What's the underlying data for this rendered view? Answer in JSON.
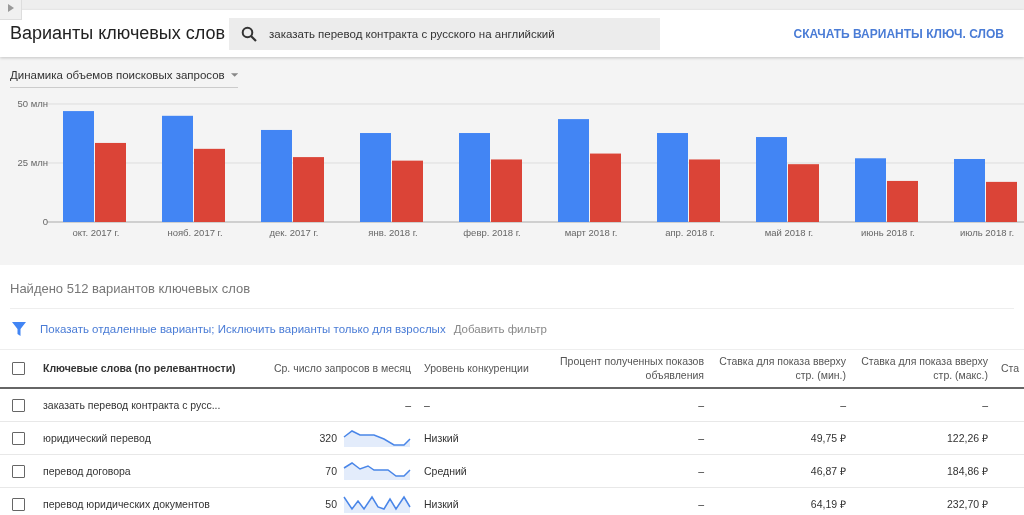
{
  "header": {
    "title": "Варианты ключевых слов",
    "search": {
      "value": "заказать перевод контракта с русского на английский"
    },
    "download_link": "СКАЧАТЬ ВАРИАНТЫ КЛЮЧ. СЛОВ"
  },
  "chart_panel": {
    "dropdown": "Динамика объемов поисковых запросов",
    "chart_data": {
      "type": "bar",
      "categories": [
        "окт. 2017 г.",
        "нояб. 2017 г.",
        "дек. 2017 г.",
        "янв. 2018 г.",
        "февр. 2018 г.",
        "март 2018 г.",
        "апр. 2018 г.",
        "май 2018 г.",
        "июнь 2018 г.",
        "июль 2018 г."
      ],
      "series": [
        {
          "color": "#4285f4",
          "values": [
            47,
            45,
            39,
            37.7,
            37.7,
            43.6,
            37.7,
            36,
            27,
            26.7
          ]
        },
        {
          "color": "#db4437",
          "values": [
            33.5,
            31,
            27.5,
            26,
            26.5,
            29,
            26.5,
            24.5,
            17.4,
            17
          ]
        }
      ],
      "ylim": [
        0,
        50
      ],
      "yticks": [
        {
          "value": 0,
          "label": "0"
        },
        {
          "value": 25,
          "label": "25 млн"
        },
        {
          "value": 50,
          "label": "50 млн"
        }
      ]
    }
  },
  "results": {
    "summary": "Найдено 512 вариантов ключевых слов",
    "filter_link": "Показать отдаленные варианты; Исключить варианты только для взрослых",
    "add_filter": "Добавить фильтр"
  },
  "table": {
    "select_all_checked": false,
    "columns": [
      "Ключевые слова (по релевантности)",
      "Ср. число запросов в месяц",
      "Уровень конкуренции",
      "Процент полученных показов объявления",
      "Ставка для показа вверху стр. (мин.)",
      "Ставка для показа вверху стр. (макс.)",
      "Ста"
    ],
    "rows": [
      {
        "checked": false,
        "keyword": "заказать перевод контракта с русс...",
        "avg_searches": "–",
        "sparkline": false,
        "competition": "–",
        "impression_share": "–",
        "bid_low": "–",
        "bid_high": "–"
      },
      {
        "checked": false,
        "keyword": "юридический перевод",
        "avg_searches": "320",
        "sparkline": true,
        "competition": "Низкий",
        "impression_share": "–",
        "bid_low": "49,75 ₽",
        "bid_high": "122,26 ₽"
      },
      {
        "checked": false,
        "keyword": "перевод договора",
        "avg_searches": "70",
        "sparkline": true,
        "competition": "Средний",
        "impression_share": "–",
        "bid_low": "46,87 ₽",
        "bid_high": "184,86 ₽"
      },
      {
        "checked": false,
        "keyword": "перевод юридических документов",
        "avg_searches": "50",
        "sparkline": true,
        "competition": "Низкий",
        "impression_share": "–",
        "bid_low": "64,19 ₽",
        "bid_high": "232,70 ₽"
      }
    ]
  }
}
